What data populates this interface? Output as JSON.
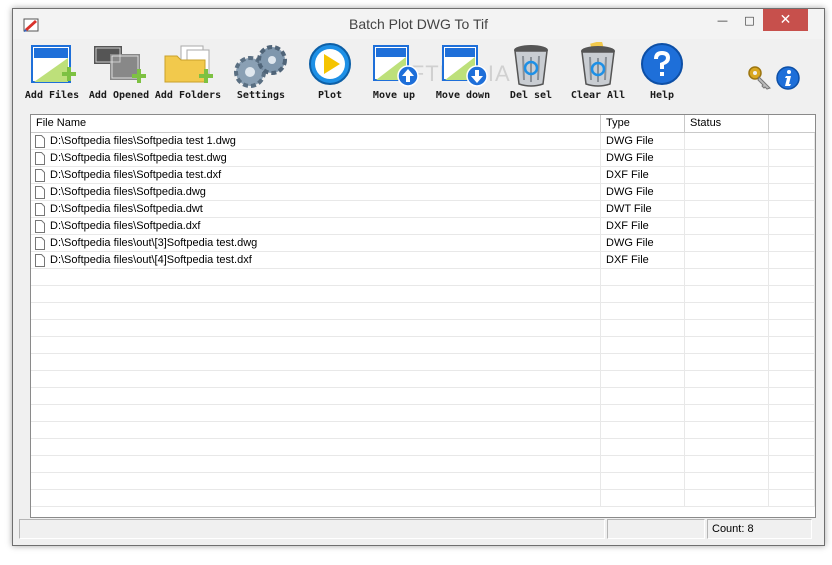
{
  "window": {
    "title": "Batch Plot DWG To Tif",
    "controls": {
      "minimize": "—",
      "maximize": "□",
      "close": "✕"
    }
  },
  "toolbar": {
    "buttons": [
      {
        "label": "Add Files",
        "icon": "add-files-icon"
      },
      {
        "label": "Add Opened",
        "icon": "add-opened-icon"
      },
      {
        "label": "Add Folders",
        "icon": "add-folders-icon"
      },
      {
        "label": "Settings",
        "icon": "gears-icon"
      },
      {
        "label": "Plot",
        "icon": "play-icon"
      },
      {
        "label": "Move up",
        "icon": "move-up-icon"
      },
      {
        "label": "Move down",
        "icon": "move-down-icon"
      },
      {
        "label": "Del sel",
        "icon": "trash-icon"
      },
      {
        "label": "Clear All",
        "icon": "trash-clear-icon"
      },
      {
        "label": "Help",
        "icon": "help-icon"
      }
    ],
    "extra_icons": [
      "key-icon",
      "info-icon"
    ],
    "watermark": "SOFTPEDIA"
  },
  "list": {
    "columns": [
      "File Name",
      "Type",
      "Status",
      ""
    ],
    "rows": [
      {
        "name": "D:\\Softpedia files\\Softpedia test 1.dwg",
        "type": "DWG File",
        "status": ""
      },
      {
        "name": "D:\\Softpedia files\\Softpedia test.dwg",
        "type": "DWG File",
        "status": ""
      },
      {
        "name": "D:\\Softpedia files\\Softpedia test.dxf",
        "type": "DXF File",
        "status": ""
      },
      {
        "name": "D:\\Softpedia files\\Softpedia.dwg",
        "type": "DWG File",
        "status": ""
      },
      {
        "name": "D:\\Softpedia files\\Softpedia.dwt",
        "type": "DWT File",
        "status": ""
      },
      {
        "name": "D:\\Softpedia files\\Softpedia.dxf",
        "type": "DXF File",
        "status": ""
      },
      {
        "name": "D:\\Softpedia files\\out\\[3]Softpedia test.dwg",
        "type": "DWG File",
        "status": ""
      },
      {
        "name": "D:\\Softpedia files\\out\\[4]Softpedia test.dxf",
        "type": "DXF File",
        "status": ""
      }
    ],
    "empty_row_count": 14
  },
  "statusbar": {
    "left": "",
    "middle": "",
    "count": "Count:  8"
  },
  "colors": {
    "accent_blue": "#1e6fd9",
    "close_red": "#c7504c",
    "folder_yellow": "#f2c94c",
    "add_green": "#7dc142"
  }
}
